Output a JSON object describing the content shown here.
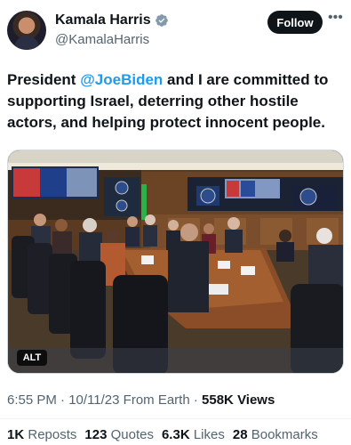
{
  "author": {
    "display_name": "Kamala Harris",
    "handle": "@KamalaHarris",
    "verified": true
  },
  "actions": {
    "follow_label": "Follow",
    "more_icon": "more-horizontal-icon"
  },
  "tweet": {
    "text_before": "President ",
    "mention": "@JoeBiden",
    "text_after": " and I are committed to supporting Israel, deterring other hostile actors, and helping protect innocent people."
  },
  "media": {
    "alt_label": "ALT"
  },
  "meta": {
    "time": "6:55 PM",
    "date": "10/11/23",
    "source": "From Earth",
    "views_count": "558K",
    "views_label": "Views"
  },
  "stats": [
    {
      "count": "1K",
      "label": "Reposts"
    },
    {
      "count": "123",
      "label": "Quotes"
    },
    {
      "count": "6.3K",
      "label": "Likes"
    },
    {
      "count": "28",
      "label": "Bookmarks"
    }
  ],
  "colors": {
    "link": "#1d9bf0",
    "verified": "#829aab",
    "follow_bg": "#0f1419",
    "secondary_text": "#536471"
  }
}
